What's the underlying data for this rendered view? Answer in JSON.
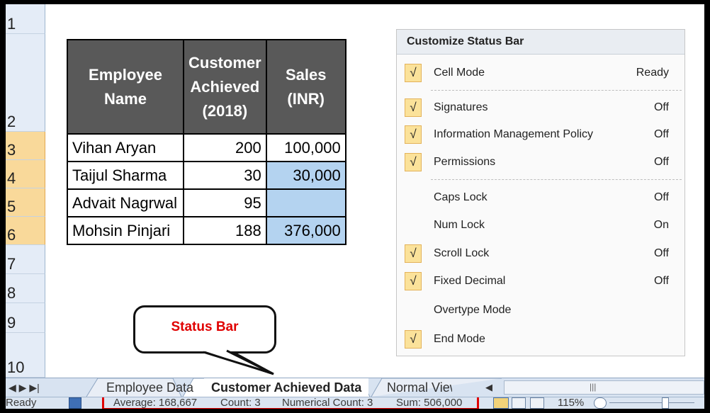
{
  "rows": [
    {
      "num": "1",
      "selected": false
    },
    {
      "num": "2",
      "selected": false
    },
    {
      "num": "3",
      "selected": true
    },
    {
      "num": "4",
      "selected": true
    },
    {
      "num": "5",
      "selected": true
    },
    {
      "num": "6",
      "selected": true
    },
    {
      "num": "7",
      "selected": false
    },
    {
      "num": "8",
      "selected": false
    },
    {
      "num": "9",
      "selected": false
    },
    {
      "num": "10",
      "selected": false
    }
  ],
  "table": {
    "headers": [
      "Employee Name",
      "Customer Achieved (2018)",
      "Sales (INR)"
    ],
    "rows": [
      {
        "name": "Vihan Aryan",
        "customers": "200",
        "sales": "100,000"
      },
      {
        "name": "Taijul Sharma",
        "customers": "30",
        "sales": "30,000"
      },
      {
        "name": "Advait Nagrwal",
        "customers": "95",
        "sales": ""
      },
      {
        "name": "Mohsin Pinjari",
        "customers": "188",
        "sales": "376,000"
      }
    ]
  },
  "menu": {
    "title": "Customize Status Bar",
    "items": [
      {
        "label": "Cell Mode",
        "value": "Ready",
        "checked": true
      },
      {
        "label": "Signatures",
        "value": "Off",
        "checked": true
      },
      {
        "label": "Information Management Policy",
        "value": "Off",
        "checked": true
      },
      {
        "label": "Permissions",
        "value": "Off",
        "checked": true
      },
      {
        "label": "Caps Lock",
        "value": "Off",
        "checked": false
      },
      {
        "label": "Num Lock",
        "value": "On",
        "checked": false
      },
      {
        "label": "Scroll Lock",
        "value": "Off",
        "checked": true
      },
      {
        "label": "Fixed Decimal",
        "value": "Off",
        "checked": true
      },
      {
        "label": "Overtype Mode",
        "value": "",
        "checked": false
      },
      {
        "label": "End Mode",
        "value": "",
        "checked": true
      }
    ],
    "check_glyph": "√"
  },
  "callout": {
    "text": "Status Bar"
  },
  "tabs": [
    "Employee Data",
    "Customer Achieved Data",
    "Normal View"
  ],
  "nav": {
    "glyphs": "◀ ▶ ▶|",
    "scroll_glyph": "|||"
  },
  "status": {
    "mode": "Ready",
    "average": "Average:  168,667",
    "count": "Count: 3",
    "numerical_count": "Numerical Count: 3",
    "sum": "Sum:  506,000",
    "zoom": "115%"
  },
  "colors": {
    "accent_red": "#e00000",
    "header_fill": "#595959",
    "selection_blue": "#b4d3f0",
    "check_fill": "#fbe29a"
  }
}
